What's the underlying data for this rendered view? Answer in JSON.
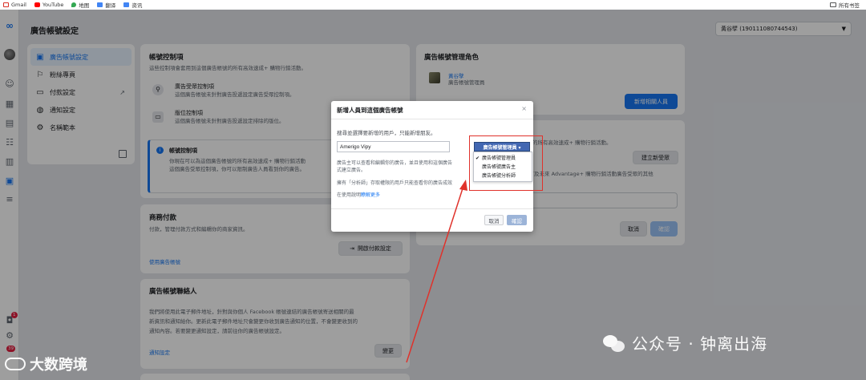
{
  "bookmarks": {
    "items": [
      {
        "label": "Gmail",
        "icon": "gmail-icon",
        "color": "#d93025"
      },
      {
        "label": "YouTube",
        "icon": "youtube-icon",
        "color": "#ff0000"
      },
      {
        "label": "地图",
        "icon": "maps-icon",
        "color": "#34a853"
      },
      {
        "label": "翻译",
        "icon": "translate-icon",
        "color": "#4285f4"
      },
      {
        "label": "资讯",
        "icon": "news-icon",
        "color": "#4285f4"
      }
    ],
    "all_bookmarks": "所有书签"
  },
  "page": {
    "title": "廣告帳號設定",
    "account_selector": "黃谷孹 (190111080744543)"
  },
  "nav": {
    "items": [
      {
        "label": "廣告帳號設定",
        "icon": "ad-account-icon",
        "selected": true
      },
      {
        "label": "粉絲專頁",
        "icon": "flag-icon",
        "selected": false
      },
      {
        "label": "付款設定",
        "icon": "credit-card-icon",
        "selected": false
      },
      {
        "label": "通知設定",
        "icon": "globe-icon",
        "selected": false
      },
      {
        "label": "名稱範本",
        "icon": "name-template-icon",
        "selected": false
      }
    ]
  },
  "account_control": {
    "title": "帳號控制項",
    "desc": "這些控制項會套用到這個廣告帳號的所有高效速成+ 購物行銷活動。",
    "items": [
      {
        "title": "廣告受眾控制項",
        "desc": "這個廣告帳號未針對廣告投遞設定廣告受眾控制項。"
      },
      {
        "title": "版位控制項",
        "desc": "這個廣告帳號未針對廣告投遞設定排除的版位。"
      }
    ],
    "info_title": "帳號控制項",
    "info_text_1": "你現在可以為這個廣告帳號的所有高效速成+ 購物行銷活動",
    "info_text_2": "這個廣告受眾控制項，你可以限制廣告人員看到你的廣告。"
  },
  "business_payment": {
    "title": "商務付款",
    "desc": "付款，管理付款方式和編輯你的商家資訊。",
    "open_button": "開啟付款設定",
    "link": "使用廣告帳號"
  },
  "ad_contact": {
    "title": "廣告帳號聯絡人",
    "desc_1": "我們將使用此電子郵件地址，針對與你個人 Facebook 帳號連結的廣告帳號寄送相關的最",
    "desc_2": "新資訊和通知給你。更新此電子郵件地址只會變更你收到廣告通知的位置，不會變更收到的",
    "desc_3": "通知內容。若要變更通知設定，請前往你的廣告帳號設定。",
    "link": "通知設定",
    "button": "變更"
  },
  "roles": {
    "title": "廣告帳號管理角色",
    "person_name": "黃谷孹",
    "person_role": "廣告帳號管理員",
    "add_button": "新增相關人員"
  },
  "right_second": {
    "desc_1": "廣告的所有高效速成+ 購物行銷活動。",
    "create_button": "建立新受眾",
    "desc_2": "你的廣告帳號中的現有及未來 Advantage+ 購物行銷活動廣告受眾的其他",
    "cancel": "取消",
    "confirm": "確認"
  },
  "modal": {
    "title": "新增人員到這個廣告帳號",
    "close": "×",
    "search_label": "搜尋並選擇要新增的用戶，只能新增朋友。",
    "input_value": "Amerigo Vipy",
    "role_selected": "廣告帳號管理員 ▾",
    "role_options": [
      {
        "label": "廣告帳號管理員",
        "checked": true
      },
      {
        "label": "廣告帳號廣告主",
        "checked": false
      },
      {
        "label": "廣告帳號分析師",
        "checked": false
      }
    ],
    "desc_1": "廣告主可以查看和編輯你的廣告，並且使用和這個廣告",
    "desc_2": "式建立廣告。",
    "desc_3": "擁有「分析師」存取權限的用戶只能查看你的廣告成效",
    "help_prefix": "在使用說明",
    "help_link": "瞭解更多",
    "cancel": "取消",
    "confirm": "確認"
  },
  "watermarks": {
    "left": "大数跨境",
    "right": "公众号 · 钟离出海"
  },
  "rail": {
    "notif_badge": "1",
    "count_badge": "39"
  },
  "colors": {
    "brand": "#1877f2",
    "highlight": "#e0322b",
    "role_select": "#4267b2"
  }
}
